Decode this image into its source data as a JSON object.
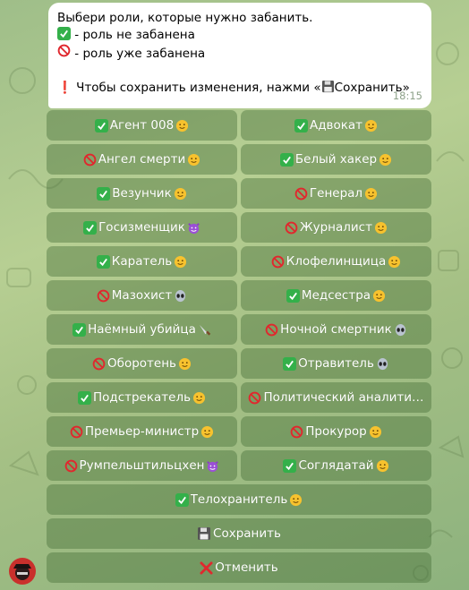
{
  "message": {
    "title": "Выбери роли, которые нужно забанить.",
    "legend_ok": "- роль не забанена",
    "legend_ban": "- роль уже забанена",
    "hint_prefix": "Чтобы сохранить изменения, нажми «",
    "hint_save": "Сохранить»",
    "time": "18:15"
  },
  "buttons": [
    {
      "label": "Агент 008",
      "status": "ok",
      "emoji": "smile"
    },
    {
      "label": "Адвокат",
      "status": "ok",
      "emoji": "smile"
    },
    {
      "label": "Ангел смерти",
      "status": "ban",
      "emoji": "smile"
    },
    {
      "label": "Белый хакер",
      "status": "ok",
      "emoji": "smile"
    },
    {
      "label": "Везунчик",
      "status": "ok",
      "emoji": "smile"
    },
    {
      "label": "Генерал",
      "status": "ban",
      "emoji": "smile"
    },
    {
      "label": "Госизменщик",
      "status": "ok",
      "emoji": "devil"
    },
    {
      "label": "Журналист",
      "status": "ban",
      "emoji": "smile"
    },
    {
      "label": "Каратель",
      "status": "ok",
      "emoji": "smile"
    },
    {
      "label": "Клофелинщица",
      "status": "ban",
      "emoji": "smile"
    },
    {
      "label": "Мазохист",
      "status": "ban",
      "emoji": "alien"
    },
    {
      "label": "Медсестра",
      "status": "ok",
      "emoji": "smile"
    },
    {
      "label": "Наёмный убийца",
      "status": "ok",
      "emoji": "knife"
    },
    {
      "label": "Ночной смертник",
      "status": "ban",
      "emoji": "alien"
    },
    {
      "label": "Оборотень",
      "status": "ban",
      "emoji": "smile"
    },
    {
      "label": "Отравитель",
      "status": "ok",
      "emoji": "alien"
    },
    {
      "label": "Подстрекатель",
      "status": "ok",
      "emoji": "smile"
    },
    {
      "label": "Политический аналити…",
      "status": "ban",
      "emoji": ""
    },
    {
      "label": "Премьер-министр",
      "status": "ban",
      "emoji": "smile"
    },
    {
      "label": "Прокурор",
      "status": "ban",
      "emoji": "smile"
    },
    {
      "label": "Румпельштильцхен",
      "status": "ban",
      "emoji": "devil"
    },
    {
      "label": "Соглядатай",
      "status": "ok",
      "emoji": "smile"
    },
    {
      "label": "Телохранитель",
      "status": "ok",
      "emoji": "smile",
      "wide": true
    }
  ],
  "actions": {
    "save_label": "Сохранить",
    "cancel_label": "Отменить"
  },
  "colors": {
    "check": "#34b04a",
    "ban": "#e0282e",
    "cancel": "#e0282e",
    "button_bg": "rgba(70,110,55,0.42)"
  }
}
